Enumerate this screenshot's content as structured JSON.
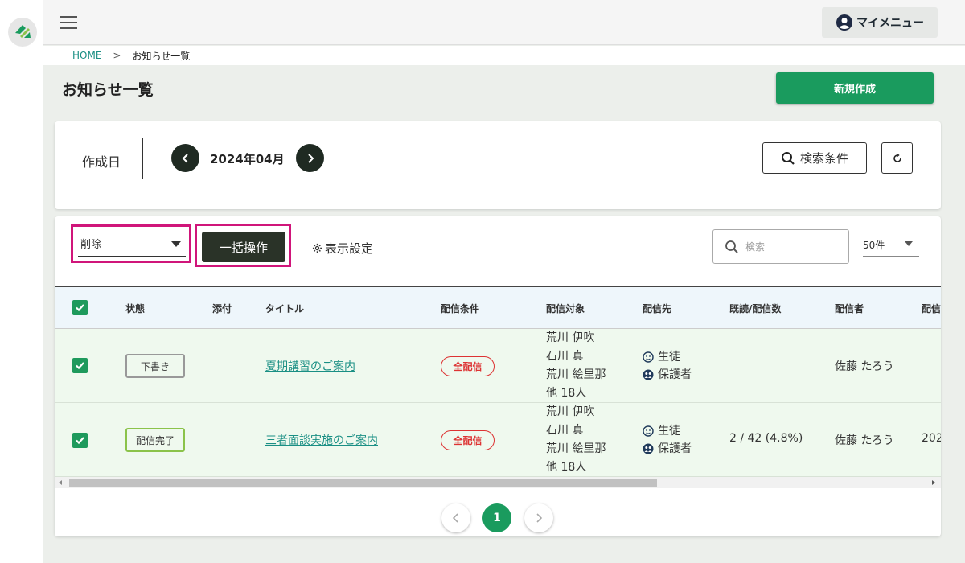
{
  "header": {
    "my_menu_label": "マイメニュー"
  },
  "breadcrumb": {
    "home": "HOME",
    "separator": ">",
    "current": "お知らせ一覧"
  },
  "page": {
    "title": "お知らせ一覧",
    "new_button": "新規作成"
  },
  "filter": {
    "date_label": "作成日",
    "month": "2024年04月",
    "search_conditions_button": "検索条件"
  },
  "toolbar": {
    "bulk_select_value": "削除",
    "bulk_button": "一括操作",
    "display_settings": "表示設定",
    "search_placeholder": "検索",
    "per_page": "50件"
  },
  "table": {
    "headers": {
      "status": "状態",
      "attach": "添付",
      "title": "タイトル",
      "condition": "配信条件",
      "targets": "配信対象",
      "destination": "配信先",
      "read": "既読/配信数",
      "sender": "配信者",
      "date": "配信"
    },
    "rows": [
      {
        "status": "下書き",
        "title": "夏期講習のご案内",
        "condition": "全配信",
        "targets": [
          "荒川 伊吹",
          "石川 真",
          "荒川 絵里那",
          "他  18人"
        ],
        "dest_student": "生徒",
        "dest_guardian": "保護者",
        "read": "",
        "sender": "佐藤 たろう",
        "date": ""
      },
      {
        "status": "配信完了",
        "title": "三者面談実施のご案内",
        "condition": "全配信",
        "targets": [
          "荒川 伊吹",
          "石川 真",
          "荒川 絵里那",
          "他  18人"
        ],
        "dest_student": "生徒",
        "dest_guardian": "保護者",
        "read": "2 / 42 (4.8%)",
        "sender": "佐藤 たろう",
        "date": "202"
      }
    ]
  },
  "pagination": {
    "current": "1"
  },
  "colors": {
    "primary_green": "#1a9b5e",
    "highlight": "#d0157a",
    "link": "#1a8f84",
    "danger": "#dd3333"
  }
}
